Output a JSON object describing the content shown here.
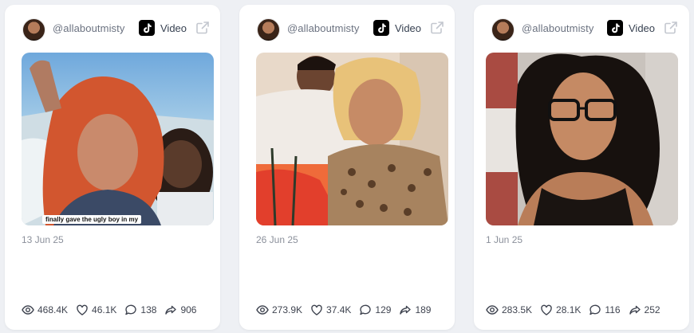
{
  "posts": [
    {
      "handle": "@allaboutmisty",
      "type": "Video",
      "caption": "finally gave the ugly boy in my",
      "date": "13 Jun 25",
      "views": "468.4K",
      "likes": "46.1K",
      "comments": "138",
      "shares": "906",
      "thumbnail": "two people at sea, wind-blown red hair"
    },
    {
      "handle": "@allaboutmisty",
      "type": "Video",
      "caption": "",
      "date": "26 Jun 25",
      "views": "273.9K",
      "likes": "37.4K",
      "comments": "129",
      "shares": "189",
      "thumbnail": "two people indoors, leopard print top"
    },
    {
      "handle": "@allaboutmisty",
      "type": "Video",
      "caption": "",
      "date": "1 Jun 25",
      "views": "283.5K",
      "likes": "28.1K",
      "comments": "116",
      "shares": "252",
      "thumbnail": "selfie with glasses and curly hair"
    }
  ],
  "icons": {
    "platform": "tiktok-icon",
    "open": "external-link-icon",
    "views": "eye-icon",
    "likes": "heart-icon",
    "comments": "comment-icon",
    "shares": "share-icon"
  },
  "colors": {
    "background": "#eef0f4",
    "card": "#ffffff",
    "muted_text": "#8b909b",
    "text": "#3f4450"
  }
}
